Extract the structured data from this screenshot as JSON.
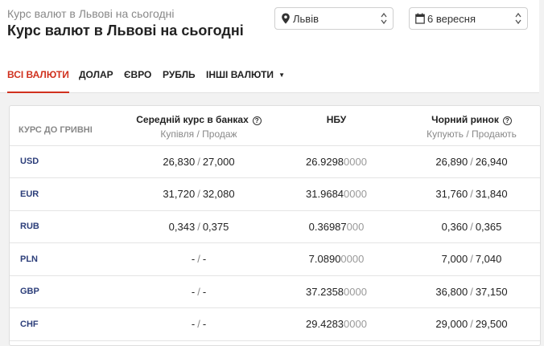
{
  "header": {
    "breadcrumb": "Курс валют в Львові на сьогодні",
    "title": "Курс валют в Львові на сьогодні",
    "city_select": {
      "value": "Львів",
      "icon": "map-pin-icon"
    },
    "date_select": {
      "value": "6 вересня",
      "icon": "calendar-icon"
    }
  },
  "tabs": [
    {
      "label": "ВСІ ВАЛЮТИ",
      "active": true
    },
    {
      "label": "ДОЛАР",
      "active": false
    },
    {
      "label": "ЄВРО",
      "active": false
    },
    {
      "label": "РУБЛЬ",
      "active": false
    },
    {
      "label": "ІНШІ ВАЛЮТИ",
      "active": false,
      "has_dropdown": true
    }
  ],
  "table": {
    "columns": {
      "name": "КУРС ДО ГРИВНІ",
      "banks": {
        "title": "Середній курс в банках",
        "subtitle": "Купівля / Продаж"
      },
      "nbu": {
        "title": "НБУ"
      },
      "black": {
        "title": "Чорний ринок",
        "subtitle": "Купують / Продають"
      }
    },
    "rows": [
      {
        "code": "USD",
        "bank_buy": "26,830",
        "bank_sell": "27,000",
        "nbu_main": "26.9298",
        "nbu_tail": "0000",
        "black_buy": "26,890",
        "black_sell": "26,940"
      },
      {
        "code": "EUR",
        "bank_buy": "31,720",
        "bank_sell": "32,080",
        "nbu_main": "31.9684",
        "nbu_tail": "0000",
        "black_buy": "31,760",
        "black_sell": "31,840"
      },
      {
        "code": "RUB",
        "bank_buy": "0,343",
        "bank_sell": "0,375",
        "nbu_main": "0.36987",
        "nbu_tail": "000",
        "black_buy": "0,360",
        "black_sell": "0,365"
      },
      {
        "code": "PLN",
        "bank_buy": "-",
        "bank_sell": "-",
        "nbu_main": "7.0890",
        "nbu_tail": "0000",
        "black_buy": "7,000",
        "black_sell": "7,040"
      },
      {
        "code": "GBP",
        "bank_buy": "-",
        "bank_sell": "-",
        "nbu_main": "37.2358",
        "nbu_tail": "0000",
        "black_buy": "36,800",
        "black_sell": "37,150"
      },
      {
        "code": "CHF",
        "bank_buy": "-",
        "bank_sell": "-",
        "nbu_main": "29.4283",
        "nbu_tail": "0000",
        "black_buy": "29,000",
        "black_sell": "29,500"
      }
    ],
    "separator": "/"
  },
  "colors": {
    "accent": "#d0311e",
    "code_text": "#2c3e7a",
    "muted": "#888888"
  }
}
